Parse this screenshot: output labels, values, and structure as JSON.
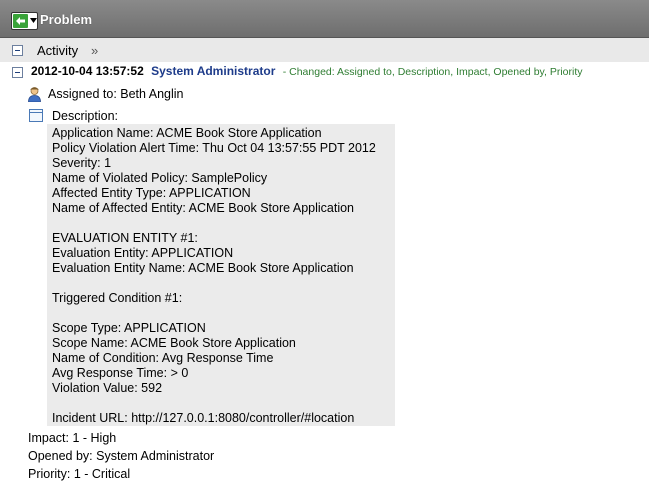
{
  "header": {
    "title": "Problem"
  },
  "activity": {
    "label": "Activity",
    "more": "»"
  },
  "entry": {
    "timestamp": "2012-10-04 13:57:52",
    "user": "System Administrator",
    "changes": "- Changed:  Assigned to, Description, Impact, Opened by, Priority",
    "assigned_to": "Assigned to: Beth Anglin",
    "description_label": "Description:",
    "description_lines": [
      "Application Name: ACME Book Store Application",
      "Policy Violation Alert Time: Thu Oct 04 13:57:55 PDT 2012",
      "Severity: 1",
      "Name of Violated Policy: SamplePolicy",
      "Affected Entity Type: APPLICATION",
      "Name of Affected Entity: ACME Book Store Application",
      "",
      "EVALUATION ENTITY #1:",
      "Evaluation Entity: APPLICATION",
      "Evaluation Entity Name: ACME Book Store Application",
      "",
      "Triggered Condition #1:",
      "",
      "Scope Type: APPLICATION",
      "Scope Name: ACME Book Store Application",
      "Name of Condition: Avg Response Time",
      "Avg Response Time: > 0",
      "Violation Value: 592",
      "",
      "Incident URL: http://127.0.0.1:8080/controller/#location"
    ],
    "impact": "Impact: 1 - High",
    "opened_by": "Opened by: System Administrator",
    "priority": "Priority: 1 - Critical"
  },
  "icons": {
    "back": "back-arrow-icon",
    "user": "user-icon",
    "description": "document-icon",
    "collapse": "collapse-icon"
  },
  "colors": {
    "header_bg": "#777777",
    "back_green": "#39a339",
    "user_blue": "#1d3b8a",
    "changed_green": "#2f7d32"
  }
}
